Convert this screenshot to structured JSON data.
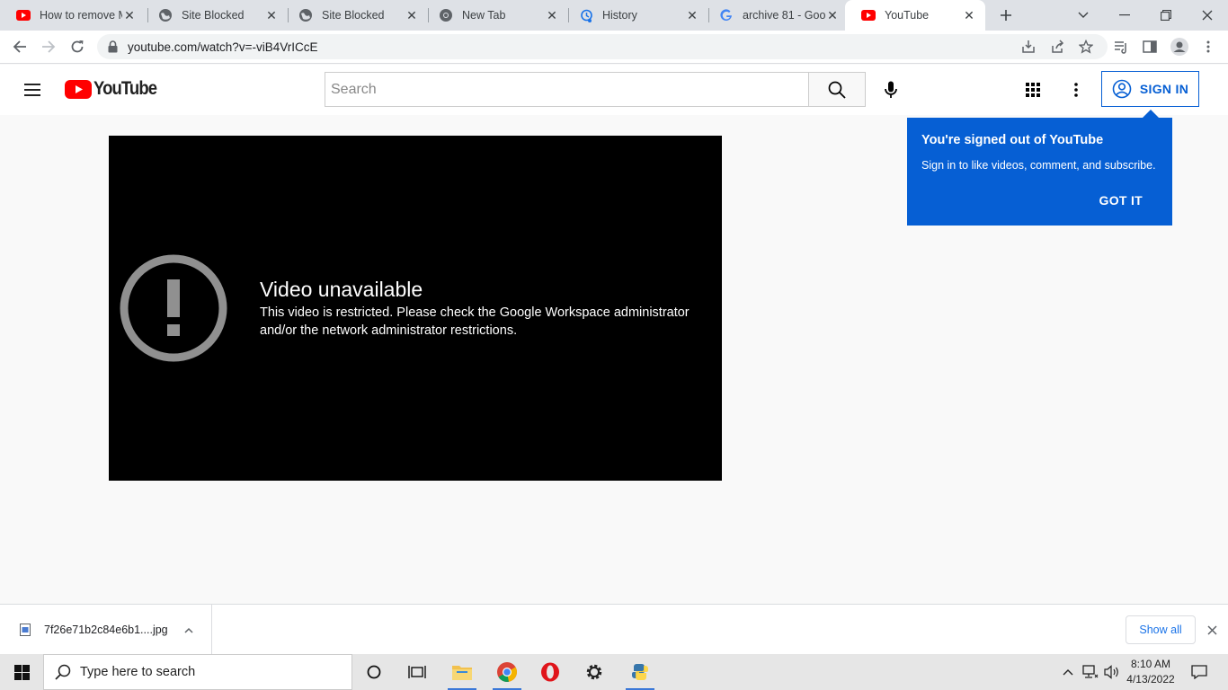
{
  "browser": {
    "tabs": [
      {
        "title": "How to remove M",
        "icon": "youtube-icon",
        "active": false
      },
      {
        "title": "Site Blocked",
        "icon": "globe-icon",
        "active": false
      },
      {
        "title": "Site Blocked",
        "icon": "globe-icon",
        "active": false
      },
      {
        "title": "New Tab",
        "icon": "chrome-icon",
        "active": false
      },
      {
        "title": "History",
        "icon": "history-icon",
        "active": false
      },
      {
        "title": "archive 81 - Goo",
        "icon": "google-icon",
        "active": false
      },
      {
        "title": "YouTube",
        "icon": "youtube-icon",
        "active": true
      }
    ],
    "close_glyph": "✕",
    "url": "youtube.com/watch?v=-viB4VrICcE"
  },
  "youtube": {
    "logo_text": "YouTube",
    "search_placeholder": "Search",
    "sign_in_label": "SIGN IN",
    "tooltip": {
      "title": "You're signed out of YouTube",
      "text": "Sign in to like videos, comment, and subscribe.",
      "button": "GOT IT"
    },
    "player": {
      "error_title": "Video unavailable",
      "error_message": "This video is restricted. Please check the Google Workspace administrator and/or the network administrator restrictions."
    },
    "colors": {
      "brand_red": "#ff0000",
      "accent_blue": "#065fd4"
    }
  },
  "downloads": {
    "file_name": "7f26e71b2c84e6b1....jpg",
    "show_all": "Show all"
  },
  "taskbar": {
    "search_placeholder": "Type here to search",
    "time": "8:10 AM",
    "date": "4/13/2022"
  }
}
